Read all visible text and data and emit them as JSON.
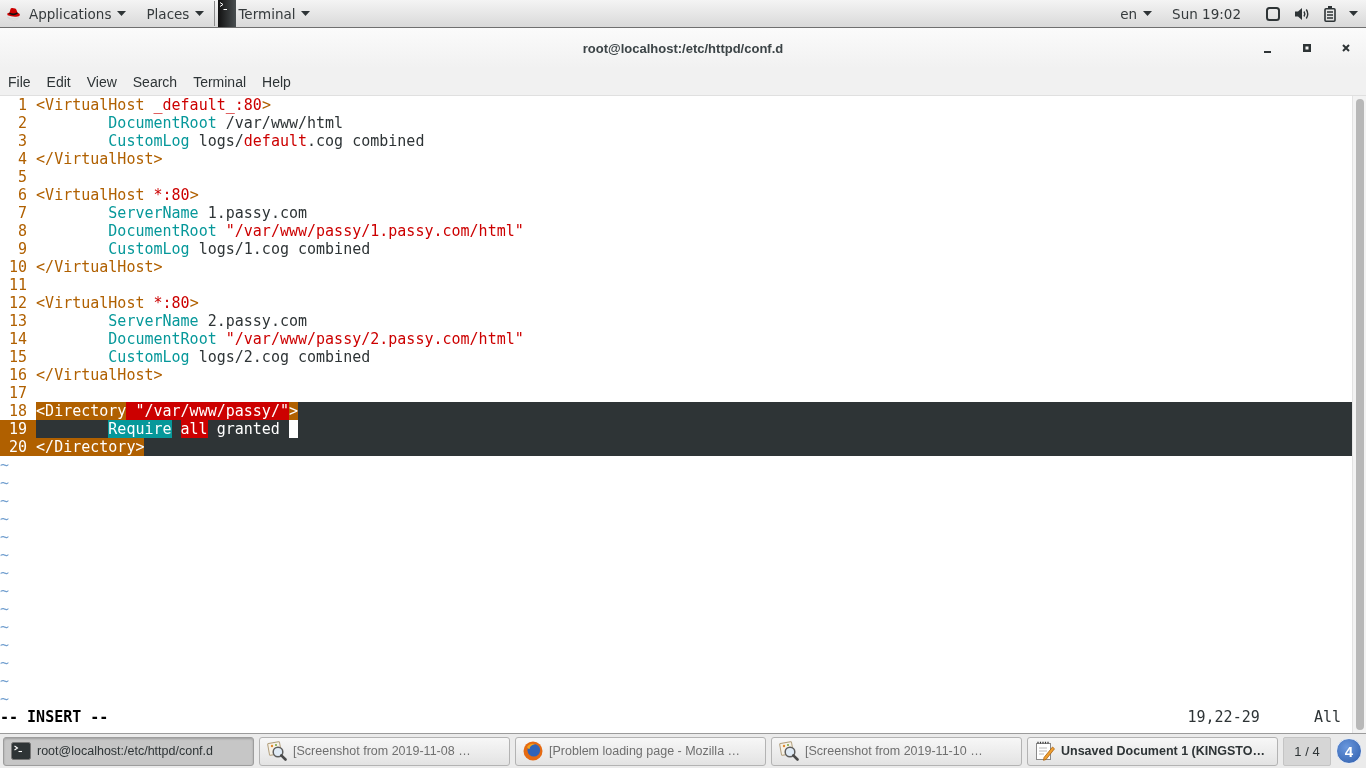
{
  "top_bar": {
    "menus": [
      "Applications",
      "Places"
    ],
    "app": "Terminal",
    "input_source": "en",
    "clock": "Sun 19:02"
  },
  "window": {
    "title": "root@localhost:/etc/httpd/conf.d"
  },
  "menu_bar": [
    "File",
    "Edit",
    "View",
    "Search",
    "Terminal",
    "Help"
  ],
  "editor": {
    "lines": [
      {
        "number": "1",
        "indented": false,
        "selected": false,
        "number_highlighted": false,
        "segments": [
          {
            "text": "<VirtualHost",
            "kind": "tag"
          },
          {
            "text": " _default_:80",
            "kind": "value"
          },
          {
            "text": ">",
            "kind": "tag"
          }
        ]
      },
      {
        "number": "2",
        "indented": true,
        "selected": false,
        "number_highlighted": false,
        "segments": [
          {
            "text": "DocumentRoot",
            "kind": "keyword"
          },
          {
            "text": " /var/www/html",
            "kind": "plain"
          }
        ]
      },
      {
        "number": "3",
        "indented": true,
        "selected": false,
        "number_highlighted": false,
        "segments": [
          {
            "text": "CustomLog",
            "kind": "keyword"
          },
          {
            "text": " logs/",
            "kind": "plain"
          },
          {
            "text": "default",
            "kind": "value"
          },
          {
            "text": ".cog combined",
            "kind": "plain"
          }
        ]
      },
      {
        "number": "4",
        "indented": false,
        "selected": false,
        "number_highlighted": false,
        "segments": [
          {
            "text": "</VirtualHost>",
            "kind": "tag"
          }
        ]
      },
      {
        "number": "5",
        "selected": false,
        "number_highlighted": false
      },
      {
        "number": "6",
        "indented": false,
        "selected": false,
        "number_highlighted": false,
        "segments": [
          {
            "text": "<VirtualHost",
            "kind": "tag"
          },
          {
            "text": " *:80",
            "kind": "value"
          },
          {
            "text": ">",
            "kind": "tag"
          }
        ]
      },
      {
        "number": "7",
        "indented": true,
        "selected": false,
        "number_highlighted": false,
        "segments": [
          {
            "text": "ServerName",
            "kind": "keyword"
          },
          {
            "text": " 1.passy.com",
            "kind": "plain"
          }
        ]
      },
      {
        "number": "8",
        "indented": true,
        "selected": false,
        "number_highlighted": false,
        "segments": [
          {
            "text": "DocumentRoot",
            "kind": "keyword"
          },
          {
            "text": " \"/var/www/passy/1.passy.com/html\"",
            "kind": "value"
          }
        ]
      },
      {
        "number": "9",
        "indented": true,
        "selected": false,
        "number_highlighted": false,
        "segments": [
          {
            "text": "CustomLog",
            "kind": "keyword"
          },
          {
            "text": " logs/1.cog combined",
            "kind": "plain"
          }
        ]
      },
      {
        "number": "10",
        "indented": false,
        "selected": false,
        "number_highlighted": false,
        "segments": [
          {
            "text": "</VirtualHost>",
            "kind": "tag"
          }
        ]
      },
      {
        "number": "11",
        "selected": false,
        "number_highlighted": false
      },
      {
        "number": "12",
        "indented": false,
        "selected": false,
        "number_highlighted": false,
        "segments": [
          {
            "text": "<VirtualHost",
            "kind": "tag"
          },
          {
            "text": " *:80",
            "kind": "value"
          },
          {
            "text": ">",
            "kind": "tag"
          }
        ]
      },
      {
        "number": "13",
        "indented": true,
        "selected": false,
        "number_highlighted": false,
        "segments": [
          {
            "text": "ServerName",
            "kind": "keyword"
          },
          {
            "text": " 2.passy.com",
            "kind": "plain"
          }
        ]
      },
      {
        "number": "14",
        "indented": true,
        "selected": false,
        "number_highlighted": false,
        "segments": [
          {
            "text": "DocumentRoot",
            "kind": "keyword"
          },
          {
            "text": " \"/var/www/passy/2.passy.com/html\"",
            "kind": "value"
          }
        ]
      },
      {
        "number": "15",
        "indented": true,
        "selected": false,
        "number_highlighted": false,
        "segments": [
          {
            "text": "CustomLog",
            "kind": "keyword"
          },
          {
            "text": " logs/2.cog combined",
            "kind": "plain"
          }
        ]
      },
      {
        "number": "16",
        "indented": false,
        "selected": false,
        "number_highlighted": false,
        "segments": [
          {
            "text": "</VirtualHost>",
            "kind": "tag"
          }
        ]
      },
      {
        "number": "17",
        "selected": false,
        "number_highlighted": false
      },
      {
        "number": "18",
        "indented": false,
        "selected": true,
        "number_highlighted": false,
        "segments": [
          {
            "text": "<Directory",
            "kind": "tag"
          },
          {
            "text": " \"/var/www/passy/\"",
            "kind": "value"
          },
          {
            "text": ">",
            "kind": "tag"
          }
        ]
      },
      {
        "number": "19",
        "indented": true,
        "selected": true,
        "number_highlighted": true,
        "segments": [
          {
            "text": "Require",
            "kind": "keyword"
          },
          {
            "kind": "space"
          },
          {
            "text": "all",
            "kind": "value"
          },
          {
            "text": " granted ",
            "kind": "plain"
          },
          {
            "kind": "cursor"
          }
        ]
      },
      {
        "number": "20",
        "indented": false,
        "selected": true,
        "number_highlighted": true,
        "segments": [
          {
            "text": "</Directory>",
            "kind": "tag"
          }
        ]
      }
    ],
    "tildes": [
      "~",
      "~",
      "~",
      "~",
      "~",
      "~",
      "~",
      "~",
      "~",
      "~",
      "~",
      "~",
      "~",
      "~"
    ],
    "mode": "-- INSERT --",
    "position": "19,22-29",
    "scroll": "All"
  },
  "taskbar": {
    "items": [
      {
        "label": "root@localhost:/etc/httpd/conf.d",
        "kind": "terminal",
        "selected": true,
        "minimized": false,
        "attention": false
      },
      {
        "label": "[Screenshot from 2019-11-08 …",
        "kind": "screenshot",
        "selected": false,
        "minimized": true,
        "attention": false
      },
      {
        "label": "[Problem loading page - Mozilla …",
        "kind": "browser",
        "selected": false,
        "minimized": true,
        "attention": false
      },
      {
        "label": "[Screenshot from 2019-11-10 …",
        "kind": "screenshot",
        "selected": false,
        "minimized": true,
        "attention": false
      },
      {
        "label": "Unsaved Document 1 (KINGSTO…",
        "kind": "editor",
        "selected": false,
        "minimized": false,
        "attention": true
      }
    ],
    "workspace": "1 / 4",
    "message_count": "4"
  }
}
